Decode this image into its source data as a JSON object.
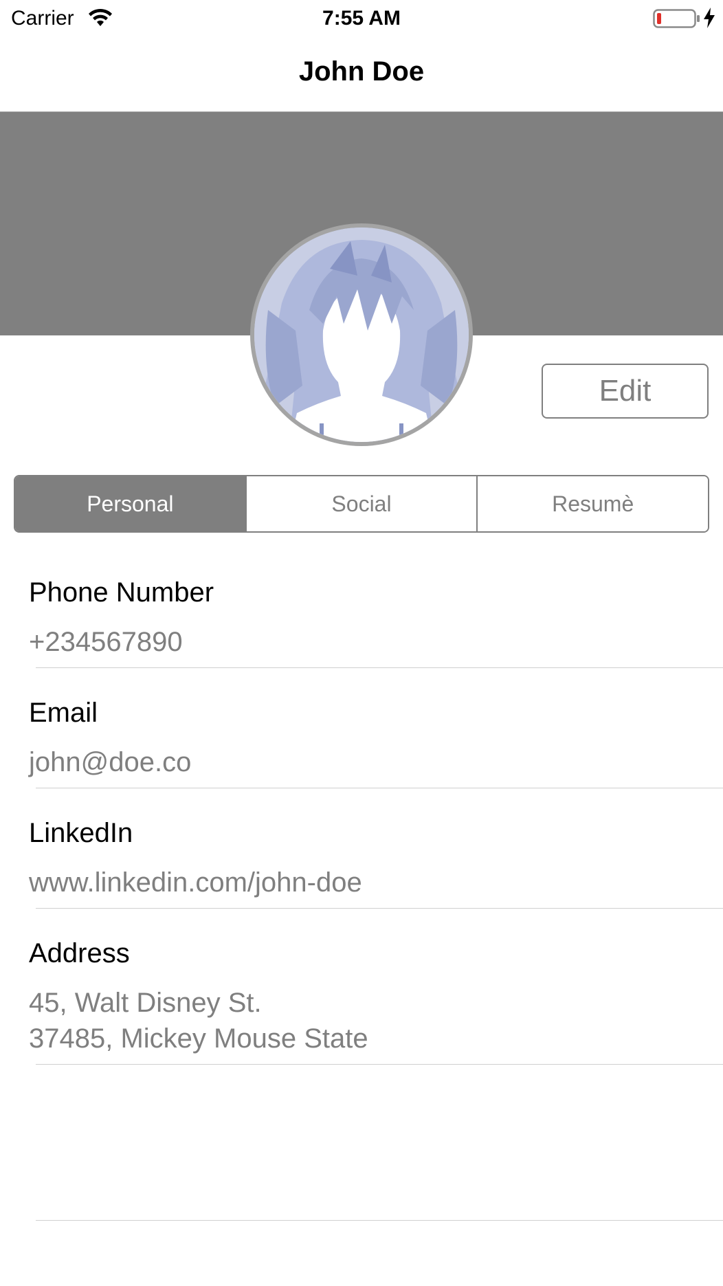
{
  "status_bar": {
    "carrier": "Carrier",
    "time": "7:55 AM",
    "icons": [
      "wifi-icon",
      "battery-low-icon",
      "charging-bolt-icon"
    ],
    "battery_color": "#e0302a"
  },
  "nav": {
    "title": "John Doe"
  },
  "header": {
    "banner_color": "#808080",
    "avatar": "anime-silhouette-avatar"
  },
  "edit_button": {
    "label": "Edit"
  },
  "tabs": [
    {
      "label": "Personal",
      "selected": true
    },
    {
      "label": "Social",
      "selected": false
    },
    {
      "label": "Resumè",
      "selected": false
    }
  ],
  "fields": {
    "phone": {
      "label": "Phone Number",
      "value": "+234567890"
    },
    "email": {
      "label": "Email",
      "value": "john@doe.co"
    },
    "linkedin": {
      "label": "LinkedIn",
      "value": "www.linkedin.com/john-doe"
    },
    "address": {
      "label": "Address",
      "value_line1": "45, Walt Disney St.",
      "value_line2": "37485, Mickey Mouse State"
    }
  },
  "colors": {
    "accent": "#7f7f7f",
    "text_primary": "#000000",
    "text_secondary": "#7f7f7f",
    "avatar_light": "#c8cee4",
    "avatar_dark": "#9aa6cf"
  }
}
